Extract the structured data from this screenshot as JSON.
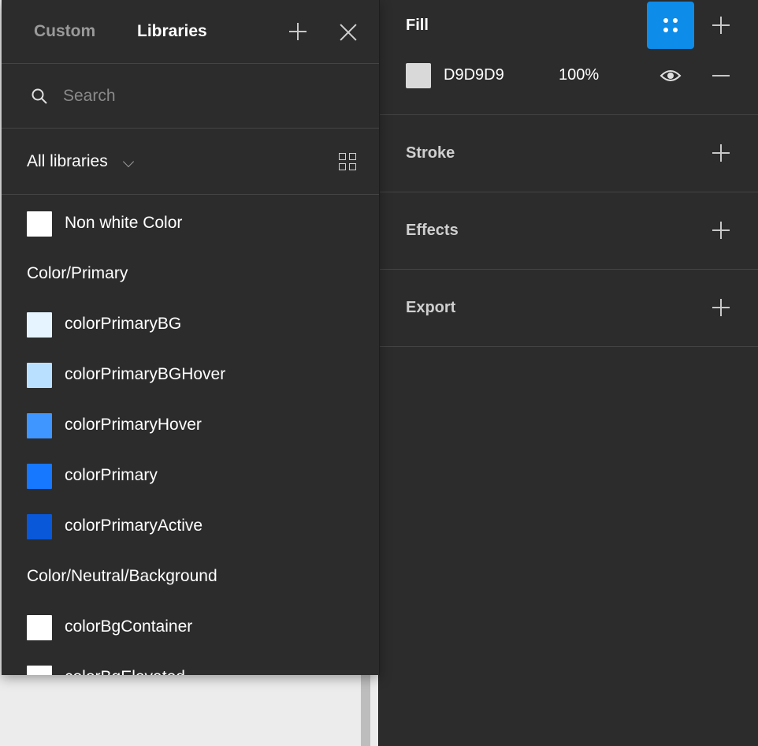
{
  "libraries_panel": {
    "tabs": [
      {
        "label": "Custom",
        "active": false
      },
      {
        "label": "Libraries",
        "active": true
      }
    ],
    "icons": {
      "add": "plus-icon",
      "close": "close-icon",
      "search": "search-icon",
      "view": "grid-view-icon",
      "dropdown": "chevron-down-icon"
    },
    "search": {
      "placeholder": "Search",
      "value": ""
    },
    "filter": {
      "label": "All libraries"
    },
    "items": [
      {
        "type": "style",
        "label": "Non white Color",
        "color": "#ffffff"
      },
      {
        "type": "group",
        "label": "Color/Primary"
      },
      {
        "type": "style",
        "label": "colorPrimaryBG",
        "color": "#e6f4ff"
      },
      {
        "type": "style",
        "label": "colorPrimaryBGHover",
        "color": "#bae0ff"
      },
      {
        "type": "style",
        "label": "colorPrimaryHover",
        "color": "#4096ff"
      },
      {
        "type": "style",
        "label": "colorPrimary",
        "color": "#1677ff"
      },
      {
        "type": "style",
        "label": "colorPrimaryActive",
        "color": "#0958d9"
      },
      {
        "type": "group",
        "label": "Color/Neutral/Background"
      },
      {
        "type": "style",
        "label": "colorBgContainer",
        "color": "#ffffff"
      },
      {
        "type": "style",
        "label": "colorBgElevated",
        "color": "#ffffff"
      }
    ]
  },
  "properties_panel": {
    "fill": {
      "title": "Fill",
      "style_button_icon": "style-dots-icon",
      "accent": "#0d8ce9",
      "layer": {
        "hex": "D9D9D9",
        "opacity": "100%",
        "color": "#d9d9d9",
        "visibility_icon": "eye-icon"
      }
    },
    "sections": [
      {
        "title": "Stroke"
      },
      {
        "title": "Effects"
      },
      {
        "title": "Export"
      }
    ]
  }
}
